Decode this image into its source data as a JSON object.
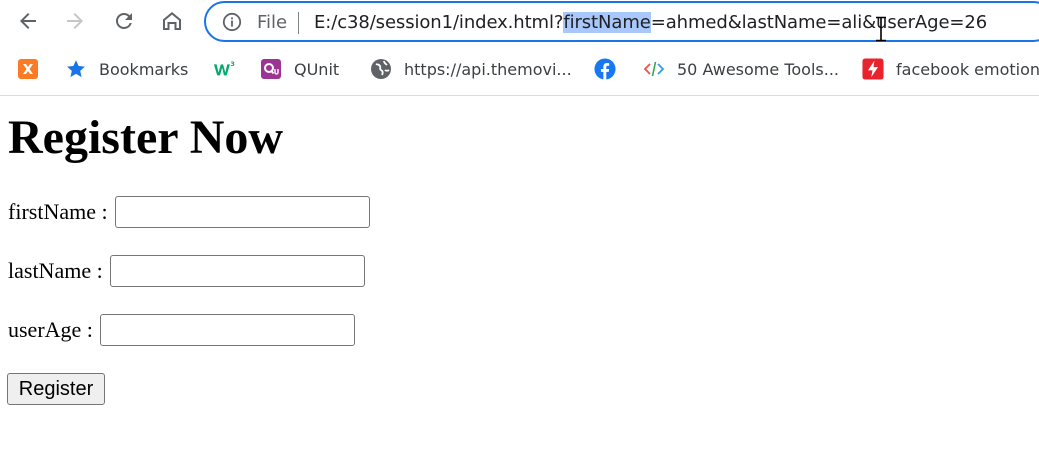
{
  "browser": {
    "scheme_label": "File",
    "url_before_highlight": "E:/c38/session1/index.html?",
    "url_highlight": "firstName",
    "url_after_highlight": "=ahmed&lastName=ali&userAge=26"
  },
  "bookmarks": [
    {
      "label": "",
      "icon": "xampp-icon"
    },
    {
      "label": "Bookmarks",
      "icon": "star-icon"
    },
    {
      "label": "",
      "icon": "w3schools-icon"
    },
    {
      "label": "QUnit",
      "icon": "qunit-icon"
    },
    {
      "label": "https://api.themovi...",
      "icon": "globe-icon"
    },
    {
      "label": "",
      "icon": "facebook-icon"
    },
    {
      "label": "50 Awesome Tools...",
      "icon": "code-icon"
    },
    {
      "label": "facebook emotion",
      "icon": "lightning-icon"
    }
  ],
  "page": {
    "title": "Register Now",
    "fields": [
      {
        "label": "firstName :",
        "value": "",
        "placeholder": ""
      },
      {
        "label": "lastName :",
        "value": "",
        "placeholder": ""
      },
      {
        "label": "userAge :",
        "value": "",
        "placeholder": ""
      }
    ],
    "submit_label": "Register"
  },
  "colors": {
    "omnibox_focus": "#1a73e8",
    "selection_highlight": "#a8c7fa",
    "facebook_blue": "#1877f2",
    "xampp_orange": "#fb7a24",
    "qunit_purple": "#9c3493",
    "w3_green": "#04aa6d",
    "lightning_red": "#e8232b"
  }
}
